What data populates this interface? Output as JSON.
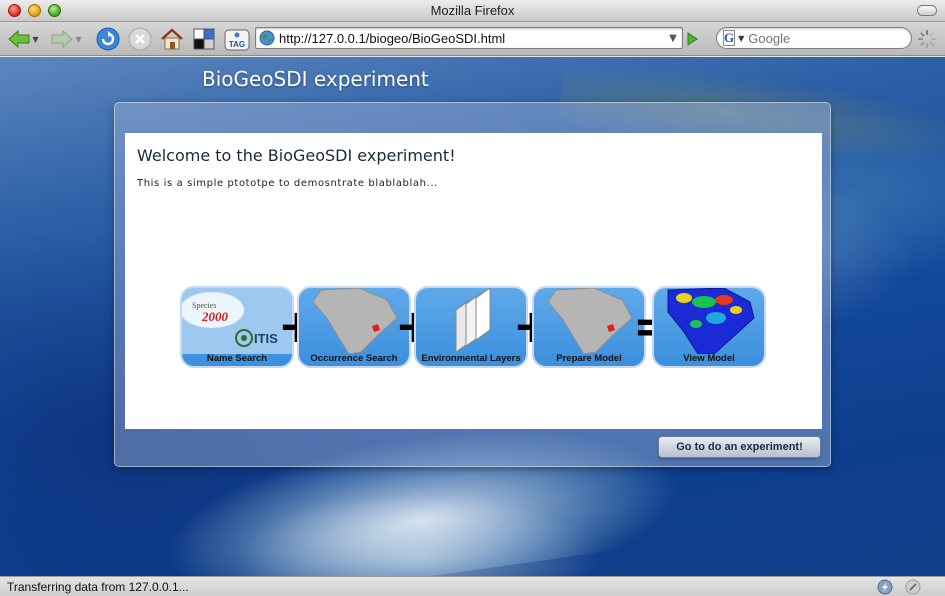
{
  "window": {
    "title": "Mozilla Firefox"
  },
  "toolbar": {
    "url": "http://127.0.0.1/biogeo/BioGeoSDI.html",
    "search_placeholder": "Google",
    "tag_label": "TAG"
  },
  "page": {
    "title": "BioGeoSDI experiment",
    "welcome_heading": "Welcome to the BioGeoSDI experiment!",
    "intro_text": "This is a simple ptototpe to demosntrate blablablah...",
    "workflow": {
      "steps": [
        {
          "label": "Name Search",
          "icon": "itis-species2000-icon",
          "logo_text": "Species",
          "logo_year": "2000",
          "logo_itis": "ITIS"
        },
        {
          "label": "Occurrence Search",
          "icon": "south-america-map-icon"
        },
        {
          "label": "Environmental Layers",
          "icon": "layers-icon"
        },
        {
          "label": "Prepare Model",
          "icon": "south-america-map-icon"
        },
        {
          "label": "View Model",
          "icon": "distribution-map-icon"
        }
      ],
      "operators": [
        "+",
        "+",
        "+",
        "="
      ]
    },
    "action_button": "Go to do an experiment!"
  },
  "statusbar": {
    "text": "Transferring data from 127.0.0.1..."
  },
  "colors": {
    "accent_blue": "#3b8fdc",
    "panel_text": "#1a2a3a",
    "button_text": "#1d2b44"
  }
}
